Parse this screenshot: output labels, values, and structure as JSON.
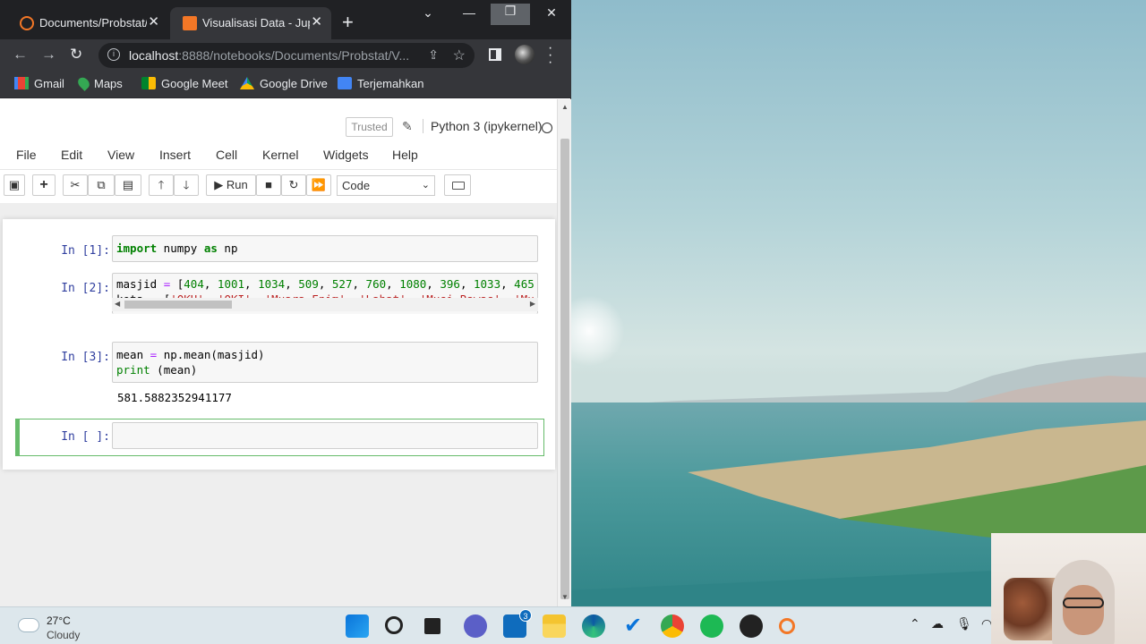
{
  "browser": {
    "tabs": [
      {
        "title": "Documents/Probstat/",
        "favicon_color": "#f37726"
      },
      {
        "title": "Visualisasi Data - Jupyter",
        "favicon_color": "#f37726"
      }
    ],
    "address": {
      "host": "localhost",
      "path": ":8888/notebooks/Documents/Probstat/V..."
    },
    "bookmarks": [
      {
        "label": "Gmail",
        "icon": "gmail-icon"
      },
      {
        "label": "Maps",
        "icon": "maps-icon"
      },
      {
        "label": "Google Meet",
        "icon": "meet-icon"
      },
      {
        "label": "Google Drive",
        "icon": "drive-icon"
      },
      {
        "label": "Terjemahkan",
        "icon": "translate-icon"
      }
    ]
  },
  "jupyter": {
    "trusted_label": "Trusted",
    "kernel_name": "Python 3 (ipykernel)",
    "menu": [
      "File",
      "Edit",
      "View",
      "Insert",
      "Cell",
      "Kernel",
      "Widgets",
      "Help"
    ],
    "toolbar": {
      "run_label": "Run",
      "cell_type": "Code"
    },
    "cells": [
      {
        "prompt": "In [1]:"
      },
      {
        "prompt": "In [2]:"
      },
      {
        "prompt": "In [3]:",
        "output": "581.5882352941177"
      },
      {
        "prompt": "In [ ]:"
      }
    ]
  },
  "taskbar": {
    "weather_temp": "27°C",
    "weather_cond": "Cloudy",
    "mail_badge": "3"
  },
  "colors": {
    "selected_cell_border": "#66bb6a",
    "prompt": "#303f9f"
  }
}
